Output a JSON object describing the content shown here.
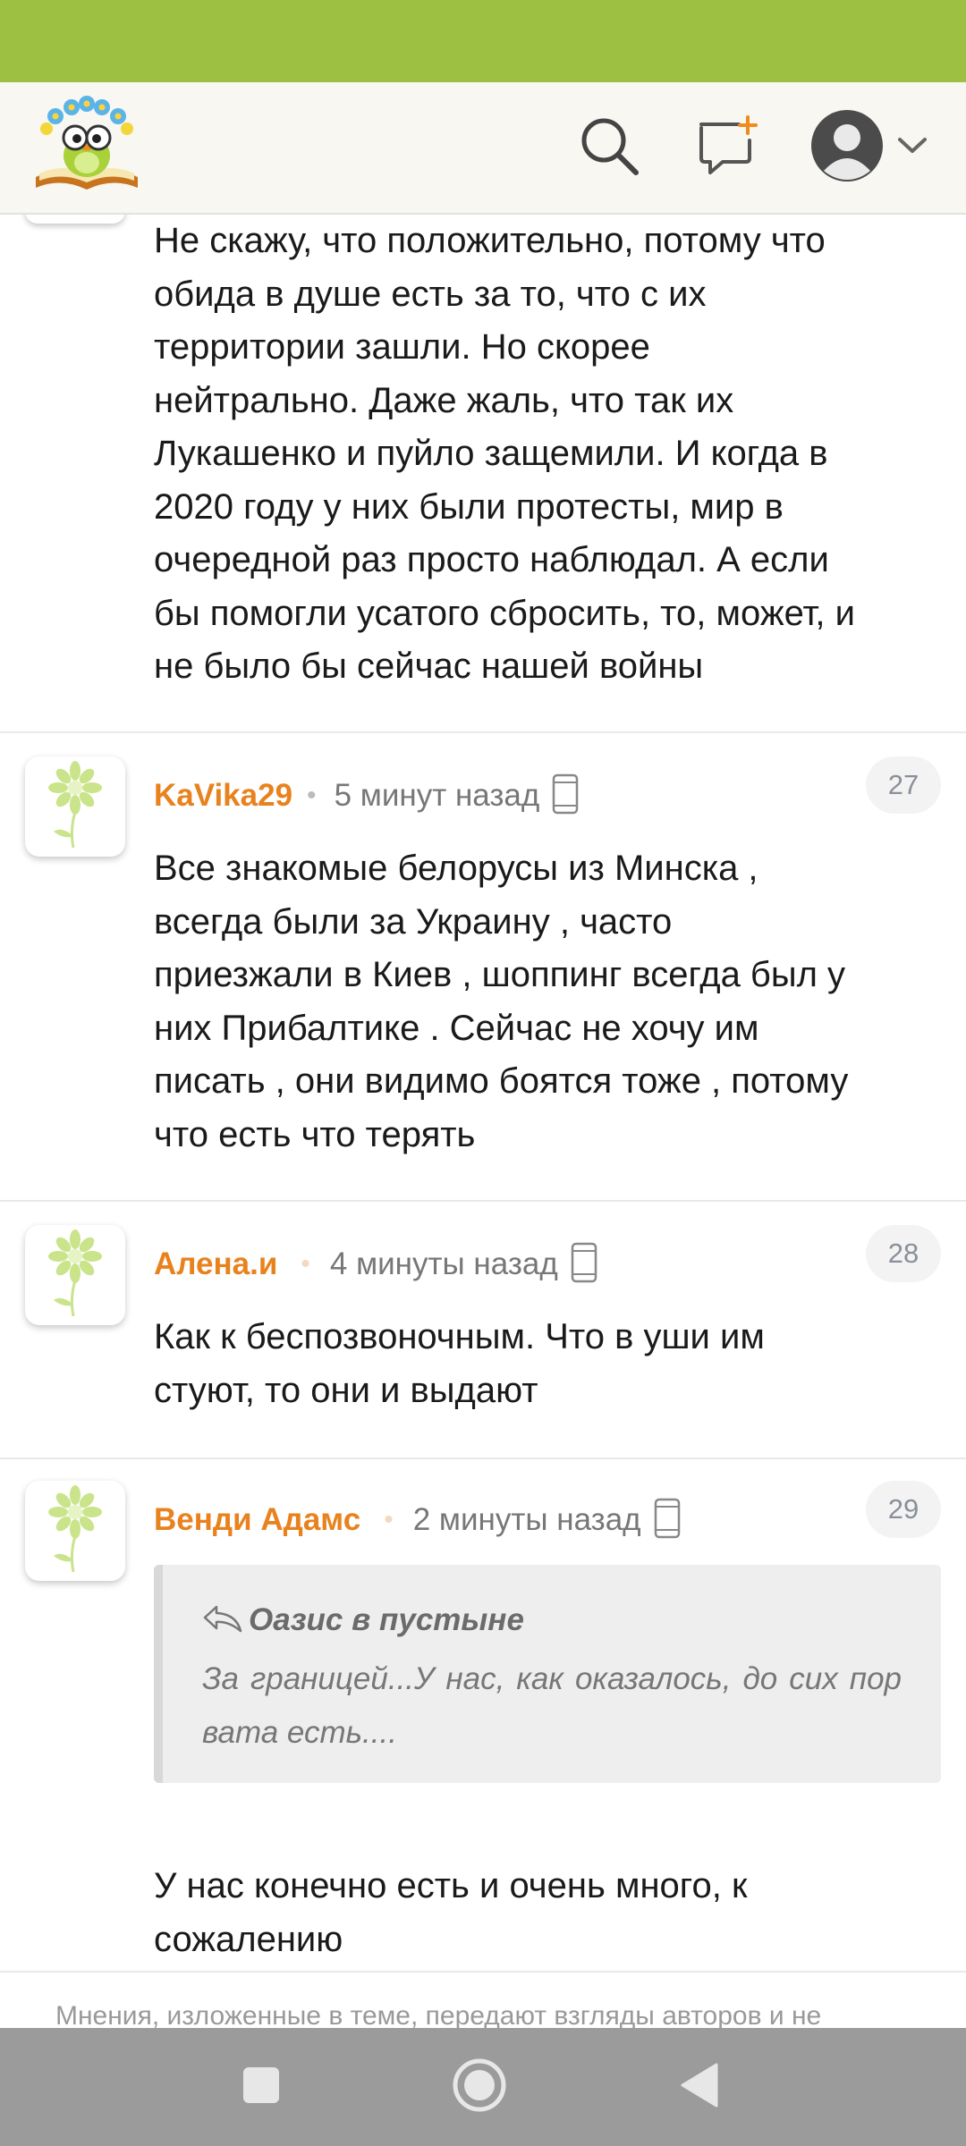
{
  "header": {
    "logo_icon": "owl-on-book-logo",
    "search_icon": "search-icon",
    "new_post_icon": "chat-plus-icon",
    "profile_icon": "user-avatar-icon",
    "accent_color": "#f08a1c",
    "status_bar_color": "#9dc043"
  },
  "previous_comment": {
    "lines": [
      "Не скажу, что положительно, потому что",
      "обида в душе есть за то, что с их",
      "территории зашли. Но скорее",
      "нейтрально. Даже жаль, что так их",
      "Лукашенко и пуйло защемили. И когда в",
      "2020 году у них были протесты, мир в",
      "очередной раз просто наблюдал. А если",
      "бы помогли усатого сбросить, то, может, и",
      "не было бы сейчас нашей войны"
    ]
  },
  "comments": [
    {
      "author": "KaVika29",
      "separator": "•",
      "time": "5 минут назад",
      "device": "mobile-phone-icon",
      "number": "27",
      "lines": [
        "Все знакомые белорусы из Минска ,",
        "всегда были за Украину , часто",
        "приезжали в Киев , шоппинг всегда был у",
        "них Прибалтике . Сейчас не хочу им",
        "писать , они видимо боятся тоже , потому",
        "что есть что терять"
      ]
    },
    {
      "author": "Алена.и",
      "separator": "•",
      "time": "4 минуты назад",
      "device": "mobile-phone-icon",
      "number": "28",
      "lines": [
        "Как к беспозвоночным. Что в уши им",
        "стуют, то они и выдают"
      ]
    },
    {
      "author": "Венди Адамс",
      "separator": "•",
      "time": "2 минуты назад",
      "device": "mobile-phone-icon",
      "number": "29",
      "quote": {
        "author": "Оазис в пустыне",
        "text": "За границей...У нас, как оказалось, до сих пор вата есть...."
      },
      "lines": [
        "У нас конечно есть и очень много, к",
        "сожалению"
      ]
    }
  ],
  "footer": {
    "disclaimer": "Мнения, изложенные в теме, передают взгляды авторов и не"
  },
  "navigation": {
    "recents": "square-icon",
    "home": "circle-icon",
    "back": "triangle-back-icon"
  }
}
